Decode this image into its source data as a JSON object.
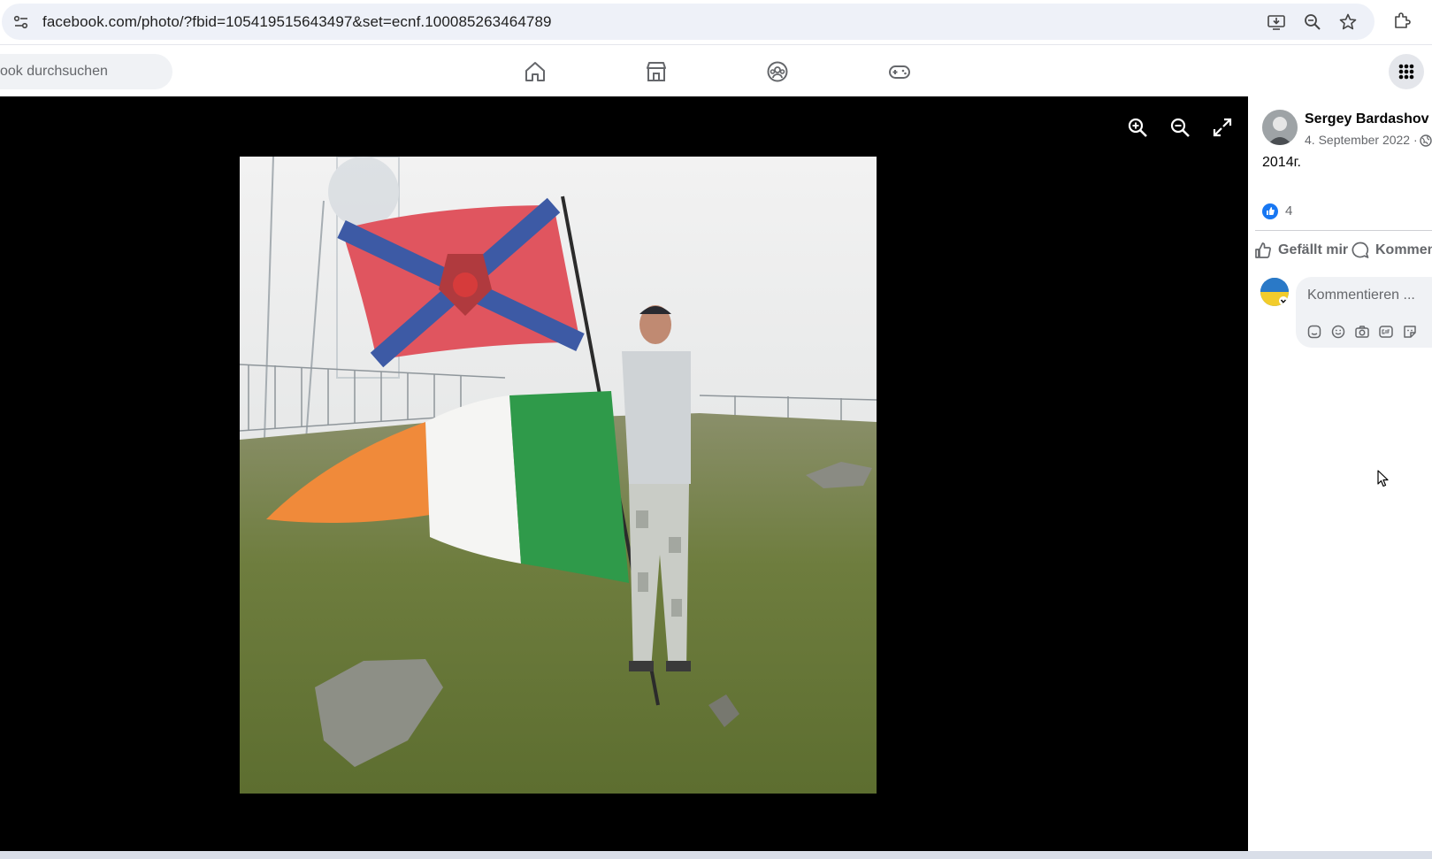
{
  "browser": {
    "url": "facebook.com/photo/?fbid=105419515643497&set=ecnf.100085263464789"
  },
  "fb_nav": {
    "search_placeholder": "ook durchsuchen",
    "icons": [
      "home-icon",
      "marketplace-icon",
      "groups-icon",
      "gaming-icon",
      "menu-grid-icon"
    ]
  },
  "viewer": {
    "controls": [
      "zoom-in-icon",
      "zoom-out-icon",
      "fullscreen-icon"
    ]
  },
  "post": {
    "author": "Sergey Bardashov",
    "date": "4. September 2022 ·",
    "text": "2014г.",
    "like_count": "4",
    "like_label": "Gefällt mir",
    "comment_label": "Kommen",
    "comment_placeholder": "Kommentieren ..."
  },
  "colors": {
    "fb_blue": "#1877f2",
    "stage_bg": "#000000",
    "muted_text": "#65676b"
  }
}
